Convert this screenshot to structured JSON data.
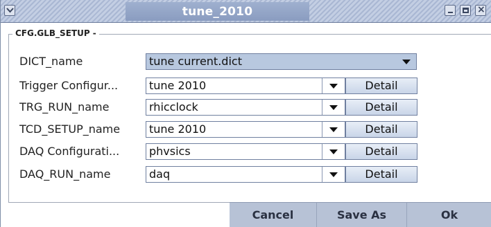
{
  "window": {
    "title": "tune_2010"
  },
  "panel": {
    "legend": "CFG.GLB_SETUP -"
  },
  "rows": [
    {
      "label": "DICT_name",
      "value": "tune current.dict",
      "has_detail": false
    },
    {
      "label": "Trigger Configur...",
      "value": "tune 2010",
      "has_detail": true,
      "detail_label": "Detail"
    },
    {
      "label": "TRG_RUN_name",
      "value": "rhicclock",
      "has_detail": true,
      "detail_label": "Detail"
    },
    {
      "label": "TCD_SETUP_name",
      "value": "tune 2010",
      "has_detail": true,
      "detail_label": "Detail"
    },
    {
      "label": "DAQ Configurati...",
      "value": "phvsics",
      "has_detail": true,
      "detail_label": "Detail"
    },
    {
      "label": "DAQ_RUN_name",
      "value": "daq",
      "has_detail": true,
      "detail_label": "Detail"
    }
  ],
  "buttons": {
    "cancel": "Cancel",
    "save_as": "Save As",
    "ok": "Ok"
  },
  "icons": {
    "menu": "chevron-down-icon",
    "minimize": "minimize-icon",
    "maximize": "maximize-icon",
    "close": "close-icon",
    "dropdown": "dropdown-arrow-icon"
  },
  "colors": {
    "titlebar": "#a9b7d3",
    "selected_combo": "#b8c8df",
    "button_bar": "#b7c2d6"
  }
}
